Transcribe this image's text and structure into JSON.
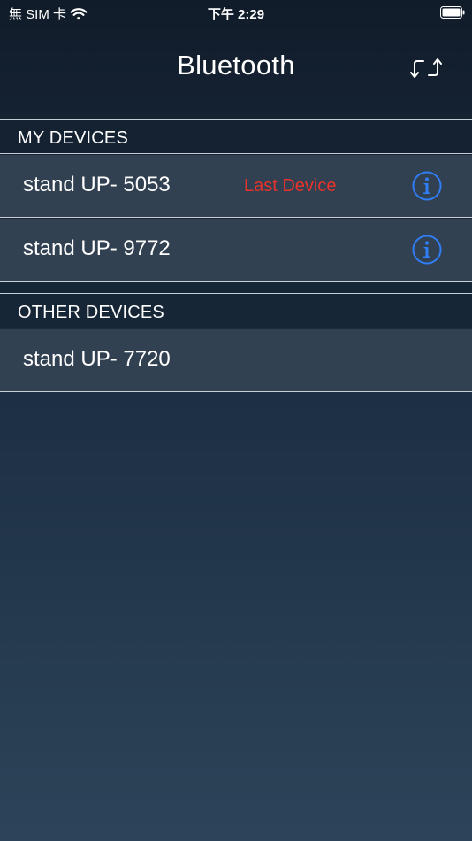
{
  "status_bar": {
    "carrier": "無 SIM 卡",
    "time": "下午 2:29",
    "wifi_icon": "wifi-icon",
    "battery_icon": "battery-icon"
  },
  "nav": {
    "title": "Bluetooth",
    "refresh_icon": "refresh-icon"
  },
  "sections": {
    "my_devices": {
      "header": "MY DEVICES",
      "devices": [
        {
          "name": "stand UP- 5053",
          "tag": "Last Device",
          "info_icon": "info-icon"
        },
        {
          "name": "stand UP- 9772",
          "tag": "",
          "info_icon": "info-icon"
        }
      ]
    },
    "other_devices": {
      "header": "OTHER DEVICES",
      "devices": [
        {
          "name": "stand UP- 7720"
        }
      ]
    }
  },
  "colors": {
    "accent_blue": "#2f7ef6",
    "last_device_red": "#e8332c",
    "row_background": "#324152",
    "separator": "#c6cfd8"
  }
}
